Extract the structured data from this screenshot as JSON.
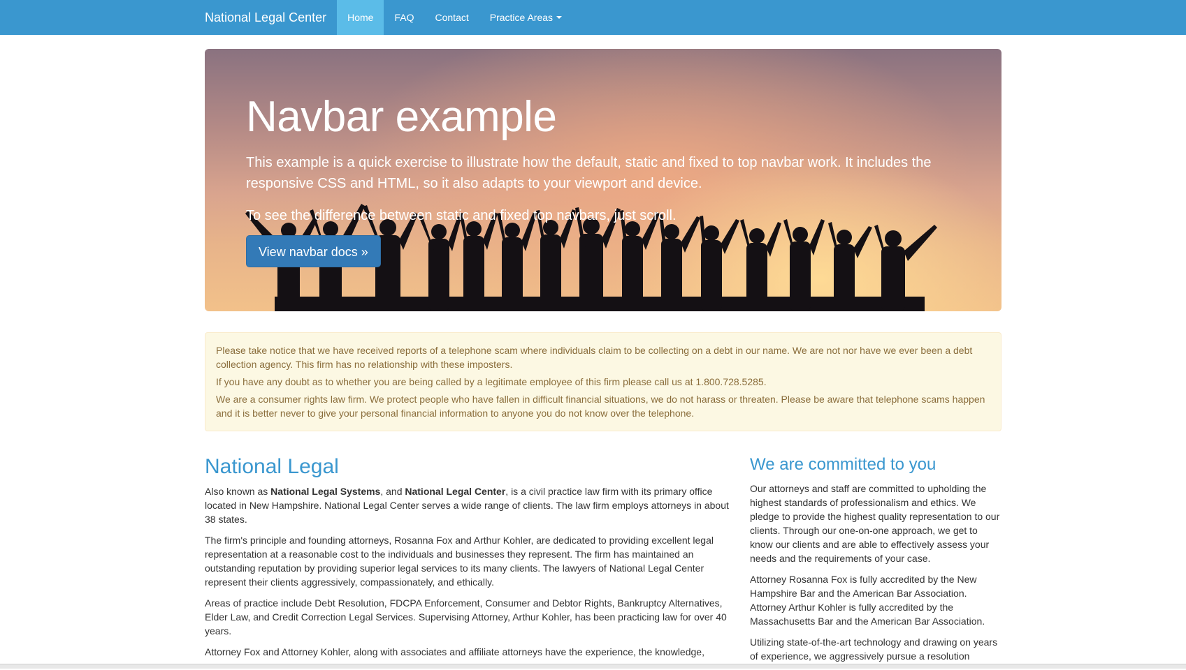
{
  "navbar": {
    "brand": "National Legal Center",
    "items": [
      {
        "label": "Home",
        "active": true
      },
      {
        "label": "FAQ",
        "active": false
      },
      {
        "label": "Contact",
        "active": false
      }
    ],
    "dropdown_label": "Practice Areas",
    "color": "#3a97cf",
    "active_color": "#5bbce8"
  },
  "hero": {
    "title": "Navbar example",
    "lead1": "This example is a quick exercise to illustrate how the default, static and fixed to top navbar work. It includes the responsive CSS and HTML, so it also adapts to your viewport and device.",
    "lead2": "To see the difference between static and fixed top navbars, just scroll.",
    "button_label": "View navbar docs »"
  },
  "notice": {
    "p1": "Please take notice that we have received reports of a telephone scam where individuals claim to be collecting on a debt in our name. We are not nor have we ever been a debt collection agency. This firm has no relationship with these imposters.",
    "p2": "If you have any doubt as to whether you are being called by a legitimate employee of this firm please call us at 1.800.728.5285.",
    "p3": "We are a consumer rights law firm. We protect people who have fallen in difficult financial situations, we do not harass or threaten. Please be aware that telephone scams happen and it is better never to give your personal financial information to anyone you do not know over the telephone."
  },
  "main": {
    "heading": "National Legal",
    "p1_pre": "Also known as ",
    "p1_bold1": "National Legal Systems",
    "p1_mid": ", and ",
    "p1_bold2": "National Legal Center",
    "p1_post": ", is a civil practice law firm with its primary office located in New Hampshire. National Legal Center serves a wide range of clients. The law firm employs attorneys in about 38 states.",
    "p2": "The firm's principle and founding attorneys, Rosanna Fox and Arthur Kohler, are dedicated to providing excellent legal representation at a reasonable cost to the individuals and businesses they represent. The firm has maintained an outstanding reputation by providing superior legal services to its many clients. The lawyers of National Legal Center represent their clients aggressively, compassionately, and ethically.",
    "p3": "Areas of practice include Debt Resolution, FDCPA Enforcement, Consumer and Debtor Rights, Bankruptcy Alternatives, Elder Law, and Credit Correction Legal Services. Supervising Attorney, Arthur Kohler, has been practicing law for over 40 years.",
    "p4": "Attorney Fox and Attorney Kohler, along with associates and affiliate attorneys have the experience, the knowledge,"
  },
  "side": {
    "heading": "We are committed to you",
    "p1": "Our attorneys and staff are committed to upholding the highest standards of professionalism and ethics. We pledge to provide the highest quality representation to our clients. Through our one-on-one approach, we get to know our clients and are able to effectively assess your needs and the requirements of your case.",
    "p2": "Attorney Rosanna Fox is fully accredited by the New Hampshire Bar and the American Bar Association. Attorney Arthur Kohler is fully accredited by the Massachusetts Bar and the American Bar Association.",
    "p3": "Utilizing state-of-the-art technology and drawing on years of experience, we aggressively pursue a resolution"
  }
}
